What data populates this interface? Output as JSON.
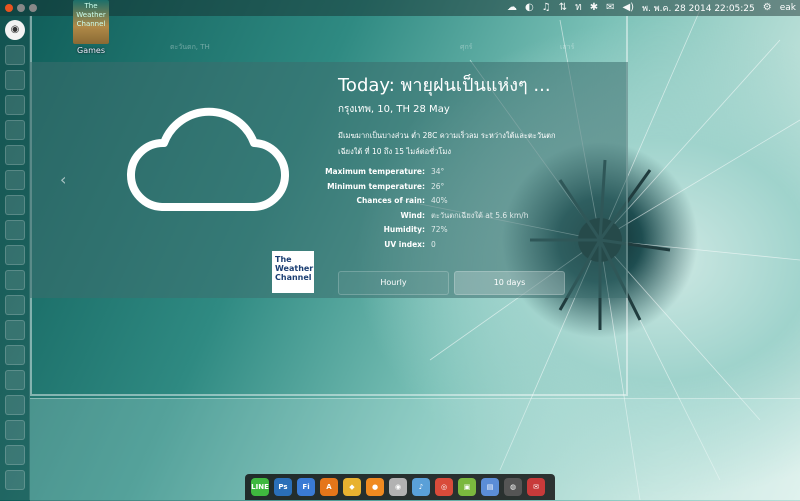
{
  "panel": {
    "indicators": [
      "cloud-icon",
      "circle-icon",
      "sound-icon",
      "network-icon",
      "thai-keyboard-icon",
      "bluetooth-icon",
      "mail-icon",
      "volume-icon"
    ],
    "clock": "พ. พ.ค. 28 2014 22:05:25",
    "user": "eak"
  },
  "desktop": {
    "icon_label": "Games",
    "icon_text": "The Weather Channel"
  },
  "ghost_forecast": [
    "ตะวันตก, TH",
    "ศุกร์",
    "เสาร์"
  ],
  "weather": {
    "headline": "Today: พายุฝนเป็นแห่งๆ ...",
    "location": "กรุงเทพ, 10, TH   28 May",
    "description": "มีเมฆมากเป็นบางส่วน ต่ำ 28C ความเร็วลม ระหว่างใต้และตะวันตกเฉียงใต้ ที่ 10 ถึง 15 ไมล์ต่อชั่วโมง",
    "stats": [
      {
        "key": "Maximum temperature:",
        "value": "34°"
      },
      {
        "key": "Minimum temperature:",
        "value": "26°"
      },
      {
        "key": "Chances of rain:",
        "value": "40%"
      },
      {
        "key": "Wind:",
        "value": "ตะวันตกเฉียงใต้ at 5.6 km/h"
      },
      {
        "key": "Humidity:",
        "value": "72%"
      },
      {
        "key": "UV index:",
        "value": "0"
      }
    ],
    "logo_text": "The Weather Channel",
    "tabs": {
      "hourly": "Hourly",
      "ten_days": "10 days"
    }
  },
  "dock_apps": [
    {
      "label": "LINE",
      "color": "#3fb83f"
    },
    {
      "label": "Ps",
      "color": "#2a6fb8"
    },
    {
      "label": "Fi",
      "color": "#3a7bd5"
    },
    {
      "label": "A",
      "color": "#e5761a"
    },
    {
      "label": "◆",
      "color": "#e8b230"
    },
    {
      "label": "●",
      "color": "#f08a20"
    },
    {
      "label": "◉",
      "color": "#b2b2b2"
    },
    {
      "label": "♪",
      "color": "#5aa0d8"
    },
    {
      "label": "◎",
      "color": "#d94b3a"
    },
    {
      "label": "▣",
      "color": "#7bb83e"
    },
    {
      "label": "▤",
      "color": "#5b8dd6"
    },
    {
      "label": "◍",
      "color": "#555555"
    },
    {
      "label": "✉",
      "color": "#c83a3a"
    }
  ]
}
